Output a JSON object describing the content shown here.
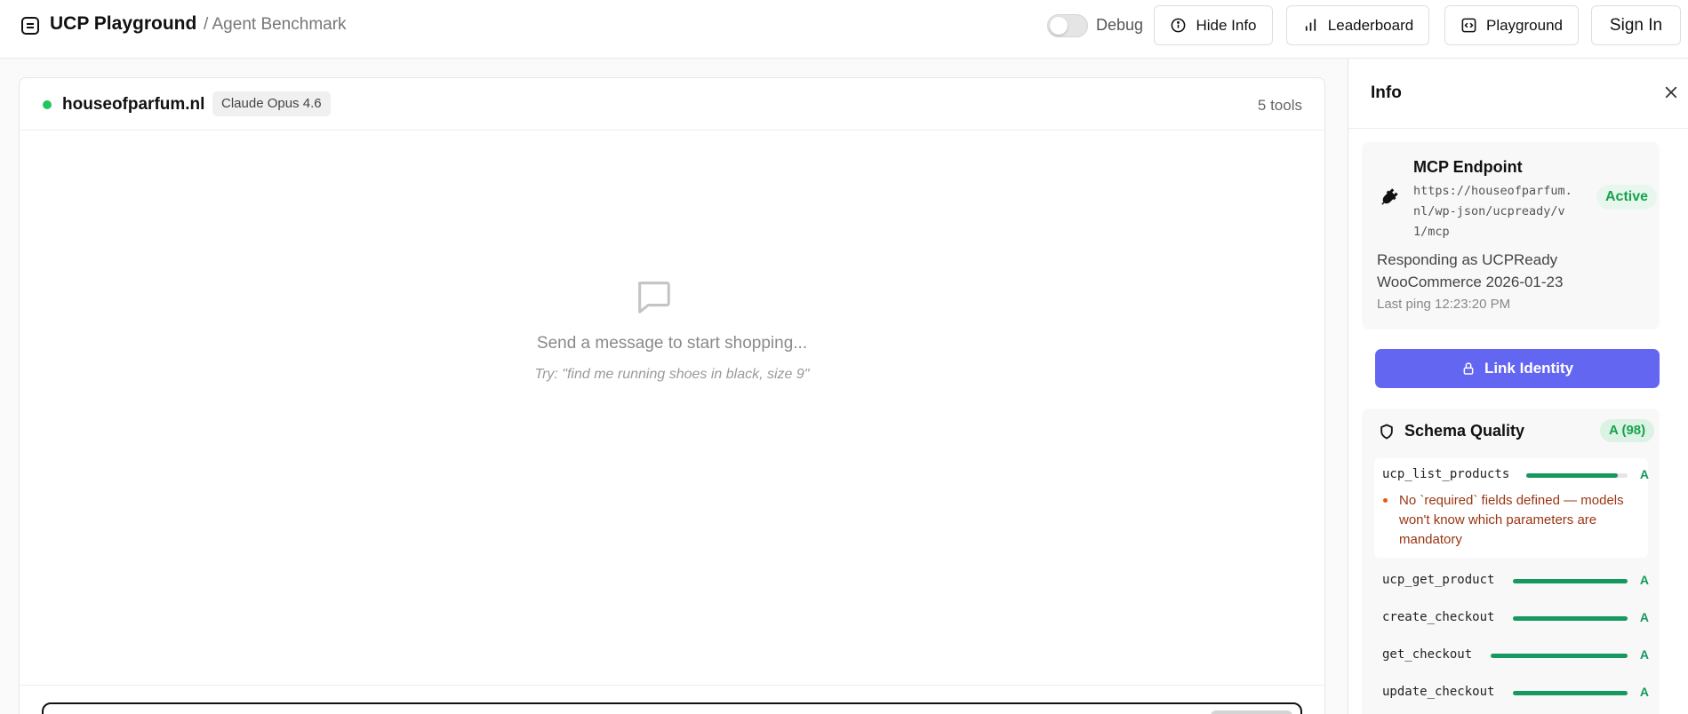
{
  "header": {
    "app_title": "UCP Playground",
    "breadcrumb": "/ Agent Benchmark",
    "debug_label": "Debug",
    "debug_enabled": false,
    "hide_info_label": "Hide Info",
    "leaderboard_label": "Leaderboard",
    "playground_label": "Playground",
    "sign_in_label": "Sign In"
  },
  "chat": {
    "shop_name": "houseofparfum.nl",
    "status_color": "#22c55e",
    "model": "Claude Opus 4.6",
    "tools_count": "5 tools",
    "empty_title": "Send a message to start shopping...",
    "empty_hint": "Try: \"find me running shoes in black, size 9\""
  },
  "info": {
    "title": "Info",
    "endpoint": {
      "title": "MCP Endpoint",
      "url": "https://houseofparfum.nl/wp-json/ucpready/v1/mcp",
      "status": "Active",
      "responding": "Responding as UCPReady WooCommerce 2026-01-23",
      "last_ping": "Last ping 12:23:20 PM"
    },
    "link_identity_label": "Link Identity",
    "schema": {
      "title": "Schema Quality",
      "grade": "A (98)",
      "tools": [
        {
          "name": "ucp_list_products",
          "score": 0.9,
          "grade": "A"
        },
        {
          "name": "ucp_get_product",
          "score": 1.0,
          "grade": "A"
        },
        {
          "name": "create_checkout",
          "score": 1.0,
          "grade": "A"
        },
        {
          "name": "get_checkout",
          "score": 1.0,
          "grade": "A"
        },
        {
          "name": "update_checkout",
          "score": 1.0,
          "grade": "A"
        }
      ],
      "warning": "No `required` fields defined — models won't know which parameters are mandatory"
    }
  },
  "colors": {
    "accent": "#6366f1",
    "success": "#15995e",
    "warning": "#9a3412"
  }
}
